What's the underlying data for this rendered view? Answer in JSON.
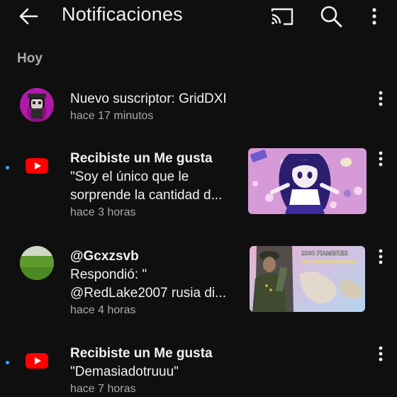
{
  "header": {
    "title": "Notificaciones",
    "back_icon": "arrow-left-icon",
    "cast_icon": "cast-icon",
    "search_icon": "search-icon",
    "more_icon": "more-vertical-icon"
  },
  "section": {
    "label": "Hoy"
  },
  "notifications": [
    {
      "type": "subscriber",
      "line1": "Nuevo suscriptor: GridDXI",
      "time": "hace 17 minutos",
      "unread": false,
      "avatar_icon": "user-avatar",
      "has_thumbnail": false
    },
    {
      "type": "like",
      "line1": "Recibiste un Me gusta",
      "line2": "\"Soy el único que le",
      "line3": "sorprende la cantidad d...",
      "time": "hace 3 horas",
      "unread": true,
      "avatar_icon": "youtube-logo-icon",
      "thumbnail": "anime-girl-flowers-thumbnail"
    },
    {
      "type": "reply",
      "line1": "@Gcxzsvb",
      "line2": "Respondió: \"",
      "line3": "@RedLake2007 rusia di...",
      "time": "hace 4 horas",
      "unread": false,
      "avatar_icon": "grass-avatar",
      "thumbnail": "2000-fiambres-map-thumbnail",
      "thumbnail_text_top": "2000 FIAMBRES",
      "thumbnail_text_bottom": "POR UN BALDE DE MADERA"
    },
    {
      "type": "like",
      "line1": "Recibiste un Me gusta",
      "line2": "\"Demasiadotruuu\"",
      "time": "hace 7 horas",
      "unread": true,
      "avatar_icon": "youtube-logo-icon",
      "has_thumbnail": false
    }
  ],
  "colors": {
    "background": "#0f0f0f",
    "text_primary": "#f1f1f1",
    "text_secondary": "#aaaaaa",
    "unread_dot": "#3ea6ff",
    "youtube_red": "#ff0000"
  }
}
